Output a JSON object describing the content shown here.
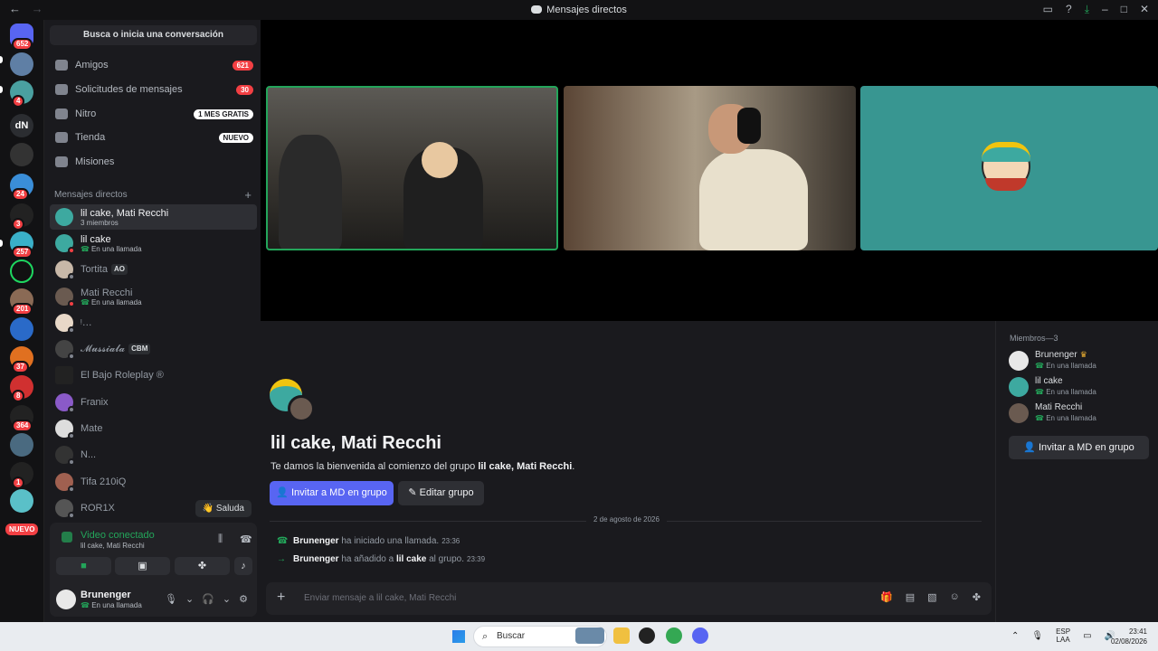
{
  "window": {
    "title": "Mensajes directos",
    "back_icon": "←",
    "forward_icon": "→"
  },
  "rail": {
    "servers": [
      {
        "badge": "652"
      },
      {
        "badge": ""
      },
      {
        "badge": "4"
      },
      {
        "label": "dN",
        "badge": ""
      },
      {
        "badge": ""
      },
      {
        "badge": "24"
      },
      {
        "badge": "3"
      },
      {
        "badge": "257"
      },
      {
        "badge": ""
      },
      {
        "badge": "201"
      },
      {
        "badge": ""
      },
      {
        "badge": "37"
      },
      {
        "badge": "8"
      },
      {
        "badge": "364"
      },
      {
        "badge": ""
      },
      {
        "badge": "1"
      }
    ],
    "new_label": "NUEVO"
  },
  "sidebar": {
    "search_label": "Busca o inicia una conversación",
    "nav": [
      {
        "label": "Amigos",
        "pill": "621"
      },
      {
        "label": "Solicitudes de mensajes",
        "pill": "30"
      },
      {
        "label": "Nitro",
        "pill": "1 MES GRATIS"
      },
      {
        "label": "Tienda",
        "pill": "NUEVO"
      },
      {
        "label": "Misiones",
        "pill": ""
      }
    ],
    "dm_header": "Mensajes directos",
    "dms": [
      {
        "name": "lil cake, Mati Recchi",
        "sub": "3 miembros"
      },
      {
        "name": "lil cake",
        "sub": "En una llamada"
      },
      {
        "name": "Tortita",
        "tag": "AO"
      },
      {
        "name": "Mati Recchi",
        "sub": "En una llamada"
      },
      {
        "name": "ᵎ…"
      },
      {
        "name": "𝓜𝓾𝓼𝓼𝓲𝓪𝓵𝓪",
        "tag": "CBM"
      },
      {
        "name": "El Bajo Roleplay ®"
      },
      {
        "name": "Franix"
      },
      {
        "name": "Mate"
      },
      {
        "name": "N..."
      },
      {
        "name": "Tifa 210iQ"
      },
      {
        "name": "ROR1X"
      }
    ],
    "saluda_label": "👋 Saluda",
    "voice": {
      "status": "Video conectado",
      "channel": "lil cake, Mati Recchi"
    },
    "user": {
      "name": "Brunenger",
      "status": "En una llamada"
    }
  },
  "chat": {
    "group_title": "lil cake, Mati Recchi",
    "welcome_prefix": "Te damos la bienvenida al comienzo del grupo ",
    "welcome_group": "lil cake, Mati Recchi",
    "welcome_suffix": ".",
    "invite_button": "Invitar a MD en grupo",
    "edit_button": "Editar grupo",
    "date_divider": "2 de agosto de 2026",
    "messages": [
      {
        "user": "Brunenger",
        "text": " ha iniciado una llamada.",
        "time": "23:36"
      },
      {
        "user": "Brunenger",
        "text_a": " ha añadido a ",
        "target": "lil cake",
        "text_b": " al grupo.",
        "time": "23:39"
      }
    ],
    "composer_placeholder": "Enviar mensaje a lil cake, Mati Recchi"
  },
  "members": {
    "header": "Miembros—3",
    "list": [
      {
        "name": "Brunenger",
        "status": "En una llamada",
        "crown": "♛"
      },
      {
        "name": "lil cake",
        "status": "En una llamada"
      },
      {
        "name": "Mati Recchi",
        "status": "En una llamada"
      }
    ],
    "invite_button": "Invitar a MD en grupo"
  },
  "taskbar": {
    "search_label": "Buscar",
    "lang_top": "ESP",
    "lang_bottom": "LAA",
    "time": "23:41",
    "date": "02/08/2026"
  },
  "colors": {
    "accent": "#5865f2",
    "online_green": "#23a55a",
    "badge_red": "#f23f43"
  }
}
